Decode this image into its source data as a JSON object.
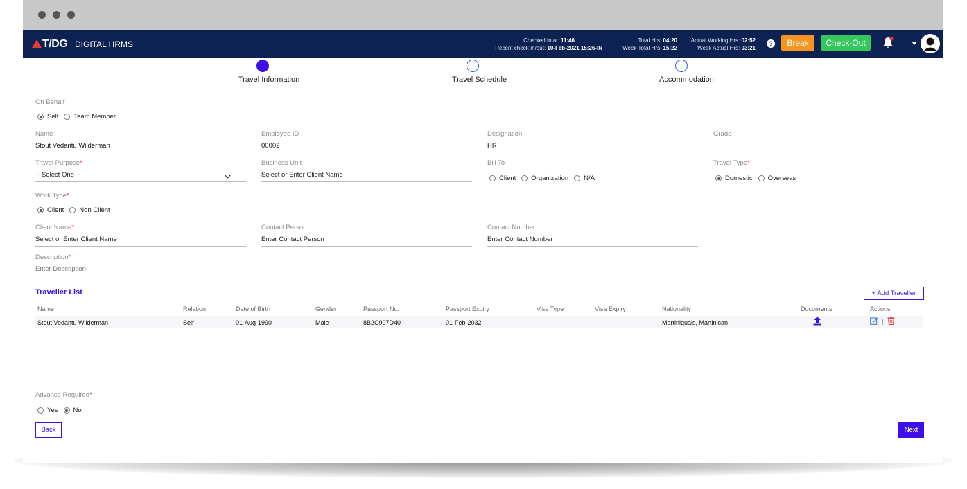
{
  "header": {
    "logo": "T/DG",
    "app_name": "DIGITAL HRMS",
    "checked_in_label": "Checked In at:",
    "checked_in_value": "11:46",
    "recent_label": "Recent check-in/out:",
    "recent_value": "10-Feb-2021 15:26-IN",
    "total_hrs_label": "Total Hrs:",
    "total_hrs_value": "04:20",
    "week_total_label": "Week Total Hrs:",
    "week_total_value": "15:22",
    "actual_working_label": "Actual Working Hrs:",
    "actual_working_value": "02:52",
    "week_actual_label": "Week Actual Hrs:",
    "week_actual_value": "03:21",
    "help_glyph": "?",
    "break_label": "Break",
    "checkout_label": "Check-Out"
  },
  "steps": [
    {
      "label": "Travel Information",
      "active": true
    },
    {
      "label": "Travel Schedule",
      "active": false
    },
    {
      "label": "Accommodation",
      "active": false
    }
  ],
  "form": {
    "on_behalf_label": "On Behalf",
    "on_behalf_options": [
      "Self",
      "Team Member"
    ],
    "name_label": "Name",
    "name_value": "Stout Vedantu Wilderman",
    "employee_id_label": "Employee ID",
    "employee_id_value": "00002",
    "designation_label": "Designation",
    "designation_value": "HR",
    "grade_label": "Grade",
    "travel_purpose_label": "Travel Purpose",
    "travel_purpose_value": "-- Select One --",
    "business_unit_label": "Business Unit",
    "business_unit_placeholder": "Select or Enter Client Name",
    "bill_to_label": "Bill To",
    "bill_to_options": [
      "Client",
      "Organization",
      "N/A"
    ],
    "travel_type_label": "Travel Type",
    "travel_type_options": [
      "Domestic",
      "Overseas"
    ],
    "work_type_label": "Work Type",
    "work_type_options": [
      "Client",
      "Non Client"
    ],
    "client_name_label": "Client Name",
    "client_name_placeholder": "Select or Enter Client Name",
    "contact_person_label": "Contact Person",
    "contact_person_placeholder": "Enter Contact Person",
    "contact_number_label": "Contact Number",
    "contact_number_placeholder": "Enter Contact Number",
    "description_label": "Description",
    "description_placeholder": "Enter Description",
    "required_mark": "*"
  },
  "traveller_list": {
    "title": "Traveller List",
    "add_label": "+ Add Traveller",
    "columns": [
      "Name",
      "Relation",
      "Date of Birth",
      "Gender",
      "Passport No.",
      "Passport Expiry",
      "Visa Type",
      "Visa Expiry",
      "Nationality",
      "Documents",
      "Actions"
    ],
    "rows": [
      {
        "name": "Stout Vedantu Wilderman",
        "relation": "Self",
        "dob": "01-Aug-1990",
        "gender": "Male",
        "passport_no": "8B2C907D40",
        "passport_expiry": "01-Feb-2032",
        "visa_type": "",
        "visa_expiry": "",
        "nationality": "Martiniquais, Martinican"
      }
    ],
    "action_separator": "|"
  },
  "advance": {
    "label": "Advance Required",
    "options": [
      "Yes",
      "No"
    ]
  },
  "footer": {
    "back_label": "Back",
    "next_label": "Next"
  },
  "colors": {
    "topbar": "#0b2253",
    "accent": "#3d10e8",
    "break": "#f7941d",
    "checkout": "#35c759",
    "delete": "#e53935"
  }
}
